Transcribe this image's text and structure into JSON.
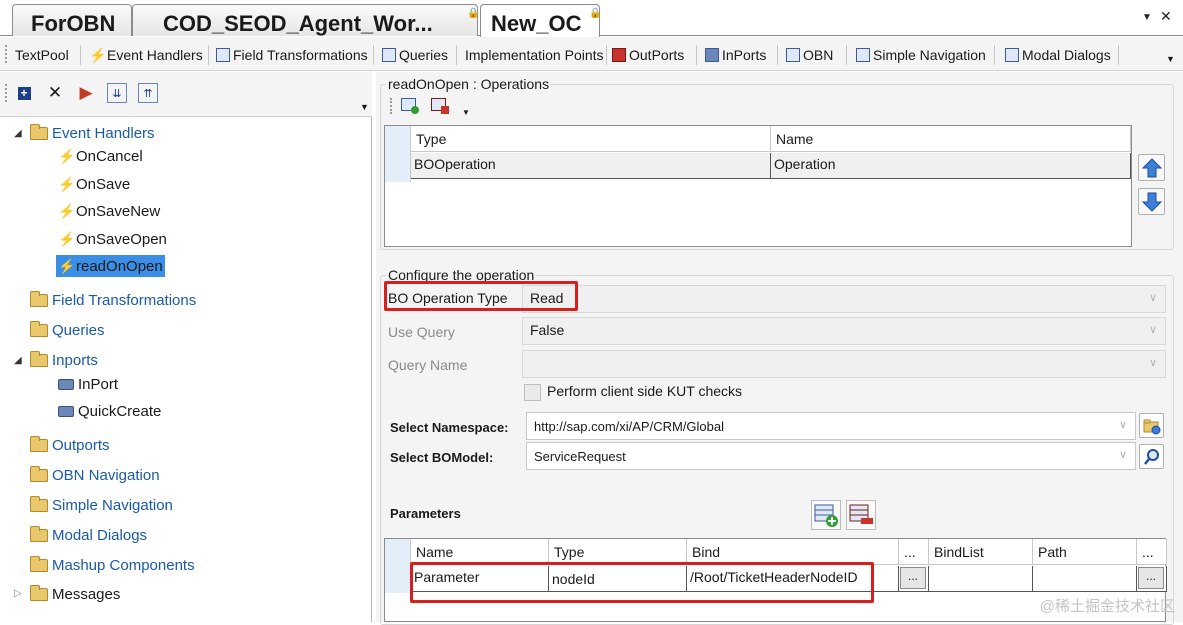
{
  "doc_tabs": [
    {
      "label": "ForOBN"
    },
    {
      "label": "COD_SEOD_Agent_Wor..."
    },
    {
      "label": "New_OC"
    }
  ],
  "toolbar": {
    "items": [
      "TextPool",
      "Event Handlers",
      "Field Transformations",
      "Queries",
      "Implementation Points",
      "OutPorts",
      "InPorts",
      "OBN",
      "Simple Navigation",
      "Modal Dialogs"
    ]
  },
  "tree": {
    "event_handlers": "Event Handlers",
    "handlers": [
      "OnCancel",
      "OnSave",
      "OnSaveNew",
      "OnSaveOpen",
      "readOnOpen"
    ],
    "field_transformations": "Field Transformations",
    "queries": "Queries",
    "inports": "Inports",
    "inport_children": [
      "InPort",
      "QuickCreate"
    ],
    "outports": "Outports",
    "obn_navigation": "OBN Navigation",
    "simple_navigation": "Simple Navigation",
    "modal_dialogs": "Modal Dialogs",
    "mashup_components": "Mashup Components",
    "messages": "Messages"
  },
  "operations": {
    "title": "readOnOpen : Operations",
    "columns": [
      "Type",
      "Name"
    ],
    "rows": [
      [
        "BOOperation",
        "Operation"
      ]
    ]
  },
  "configure": {
    "title": "Configure the operation",
    "bo_operation_type_label": "BO Operation Type",
    "bo_operation_type_value": "Read",
    "use_query_label": "Use Query",
    "use_query_value": "False",
    "query_name_label": "Query Name",
    "query_name_value": "",
    "kut_checks_label": "Perform client side KUT checks",
    "namespace_label": "Select Namespace:",
    "namespace_value": "http://sap.com/xi/AP/CRM/Global",
    "bomodel_label": "Select BOModel:",
    "bomodel_value": "ServiceRequest"
  },
  "parameters": {
    "title": "Parameters",
    "columns": [
      "Name",
      "Type",
      "Bind",
      "...",
      "BindList",
      "Path",
      "..."
    ],
    "rows": [
      {
        "name": "Parameter",
        "type": "nodeId",
        "bind": "/Root/TicketHeaderNodeID",
        "ellipsis": "...",
        "bindlist": "",
        "path": "",
        "ellipsis2": "..."
      }
    ]
  },
  "watermark": "@稀土掘金技术社区",
  "colors": {
    "highlight": "#d91e1e",
    "selection": "#3a8ee6",
    "link": "#1a5aa6"
  }
}
